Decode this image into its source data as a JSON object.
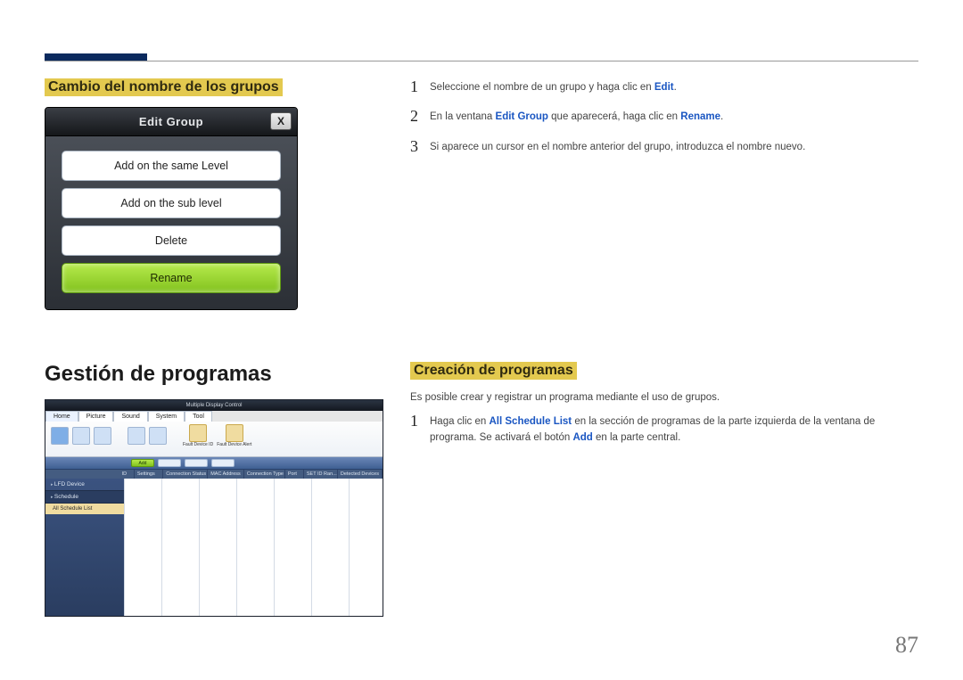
{
  "section_rename": {
    "heading": "Cambio del nombre de los grupos",
    "dialog": {
      "title": "Edit Group",
      "close": "X",
      "buttons": {
        "same_level": "Add on the same Level",
        "sub_level": "Add on the sub level",
        "delete": "Delete",
        "rename": "Rename"
      }
    },
    "steps": [
      {
        "num": "1",
        "pre": "Seleccione el nombre de un grupo y haga clic en ",
        "kw1": "Edit",
        "post": "."
      },
      {
        "num": "2",
        "pre": "En la ventana ",
        "kw1": "Edit Group",
        "mid": " que aparecerá, haga clic en ",
        "kw2": "Rename",
        "post": "."
      },
      {
        "num": "3",
        "pre": "Si aparece un cursor en el nombre anterior del grupo, introduzca el nombre nuevo.",
        "kw1": "",
        "post": ""
      }
    ]
  },
  "section_schedule": {
    "heading": "Gestión de programas",
    "subheading": "Creación de programas",
    "intro": "Es posible crear y registrar un programa mediante el uso de grupos.",
    "step": {
      "num": "1",
      "pre": "Haga clic en ",
      "kw1": "All Schedule List",
      "mid": " en la sección de programas de la parte izquierda de la ventana de programa. Se activará el botón ",
      "kw2": "Add",
      "post": " en la parte central."
    },
    "mdc": {
      "title": "Multiple Display Control",
      "tabs": {
        "home": "Home",
        "picture": "Picture",
        "sound": "Sound",
        "system": "System",
        "tool": "Tool"
      },
      "ribbon_labels": {
        "fault_id": "Fault Device ID",
        "fault_alert": "Fault Device Alert"
      },
      "toolbar": {
        "add": "Add",
        "b2": "",
        "b3": "",
        "b4": ""
      },
      "columns": [
        "ID",
        "Settings",
        "Connection Status",
        "MAC Address",
        "Connection Type",
        "Port",
        "SET ID Ran...",
        "Detected Devices"
      ],
      "sidebar": {
        "lfd": "LFD Device",
        "schedule": "Schedule",
        "all_list": "All Schedule List"
      }
    }
  },
  "page_number": "87"
}
